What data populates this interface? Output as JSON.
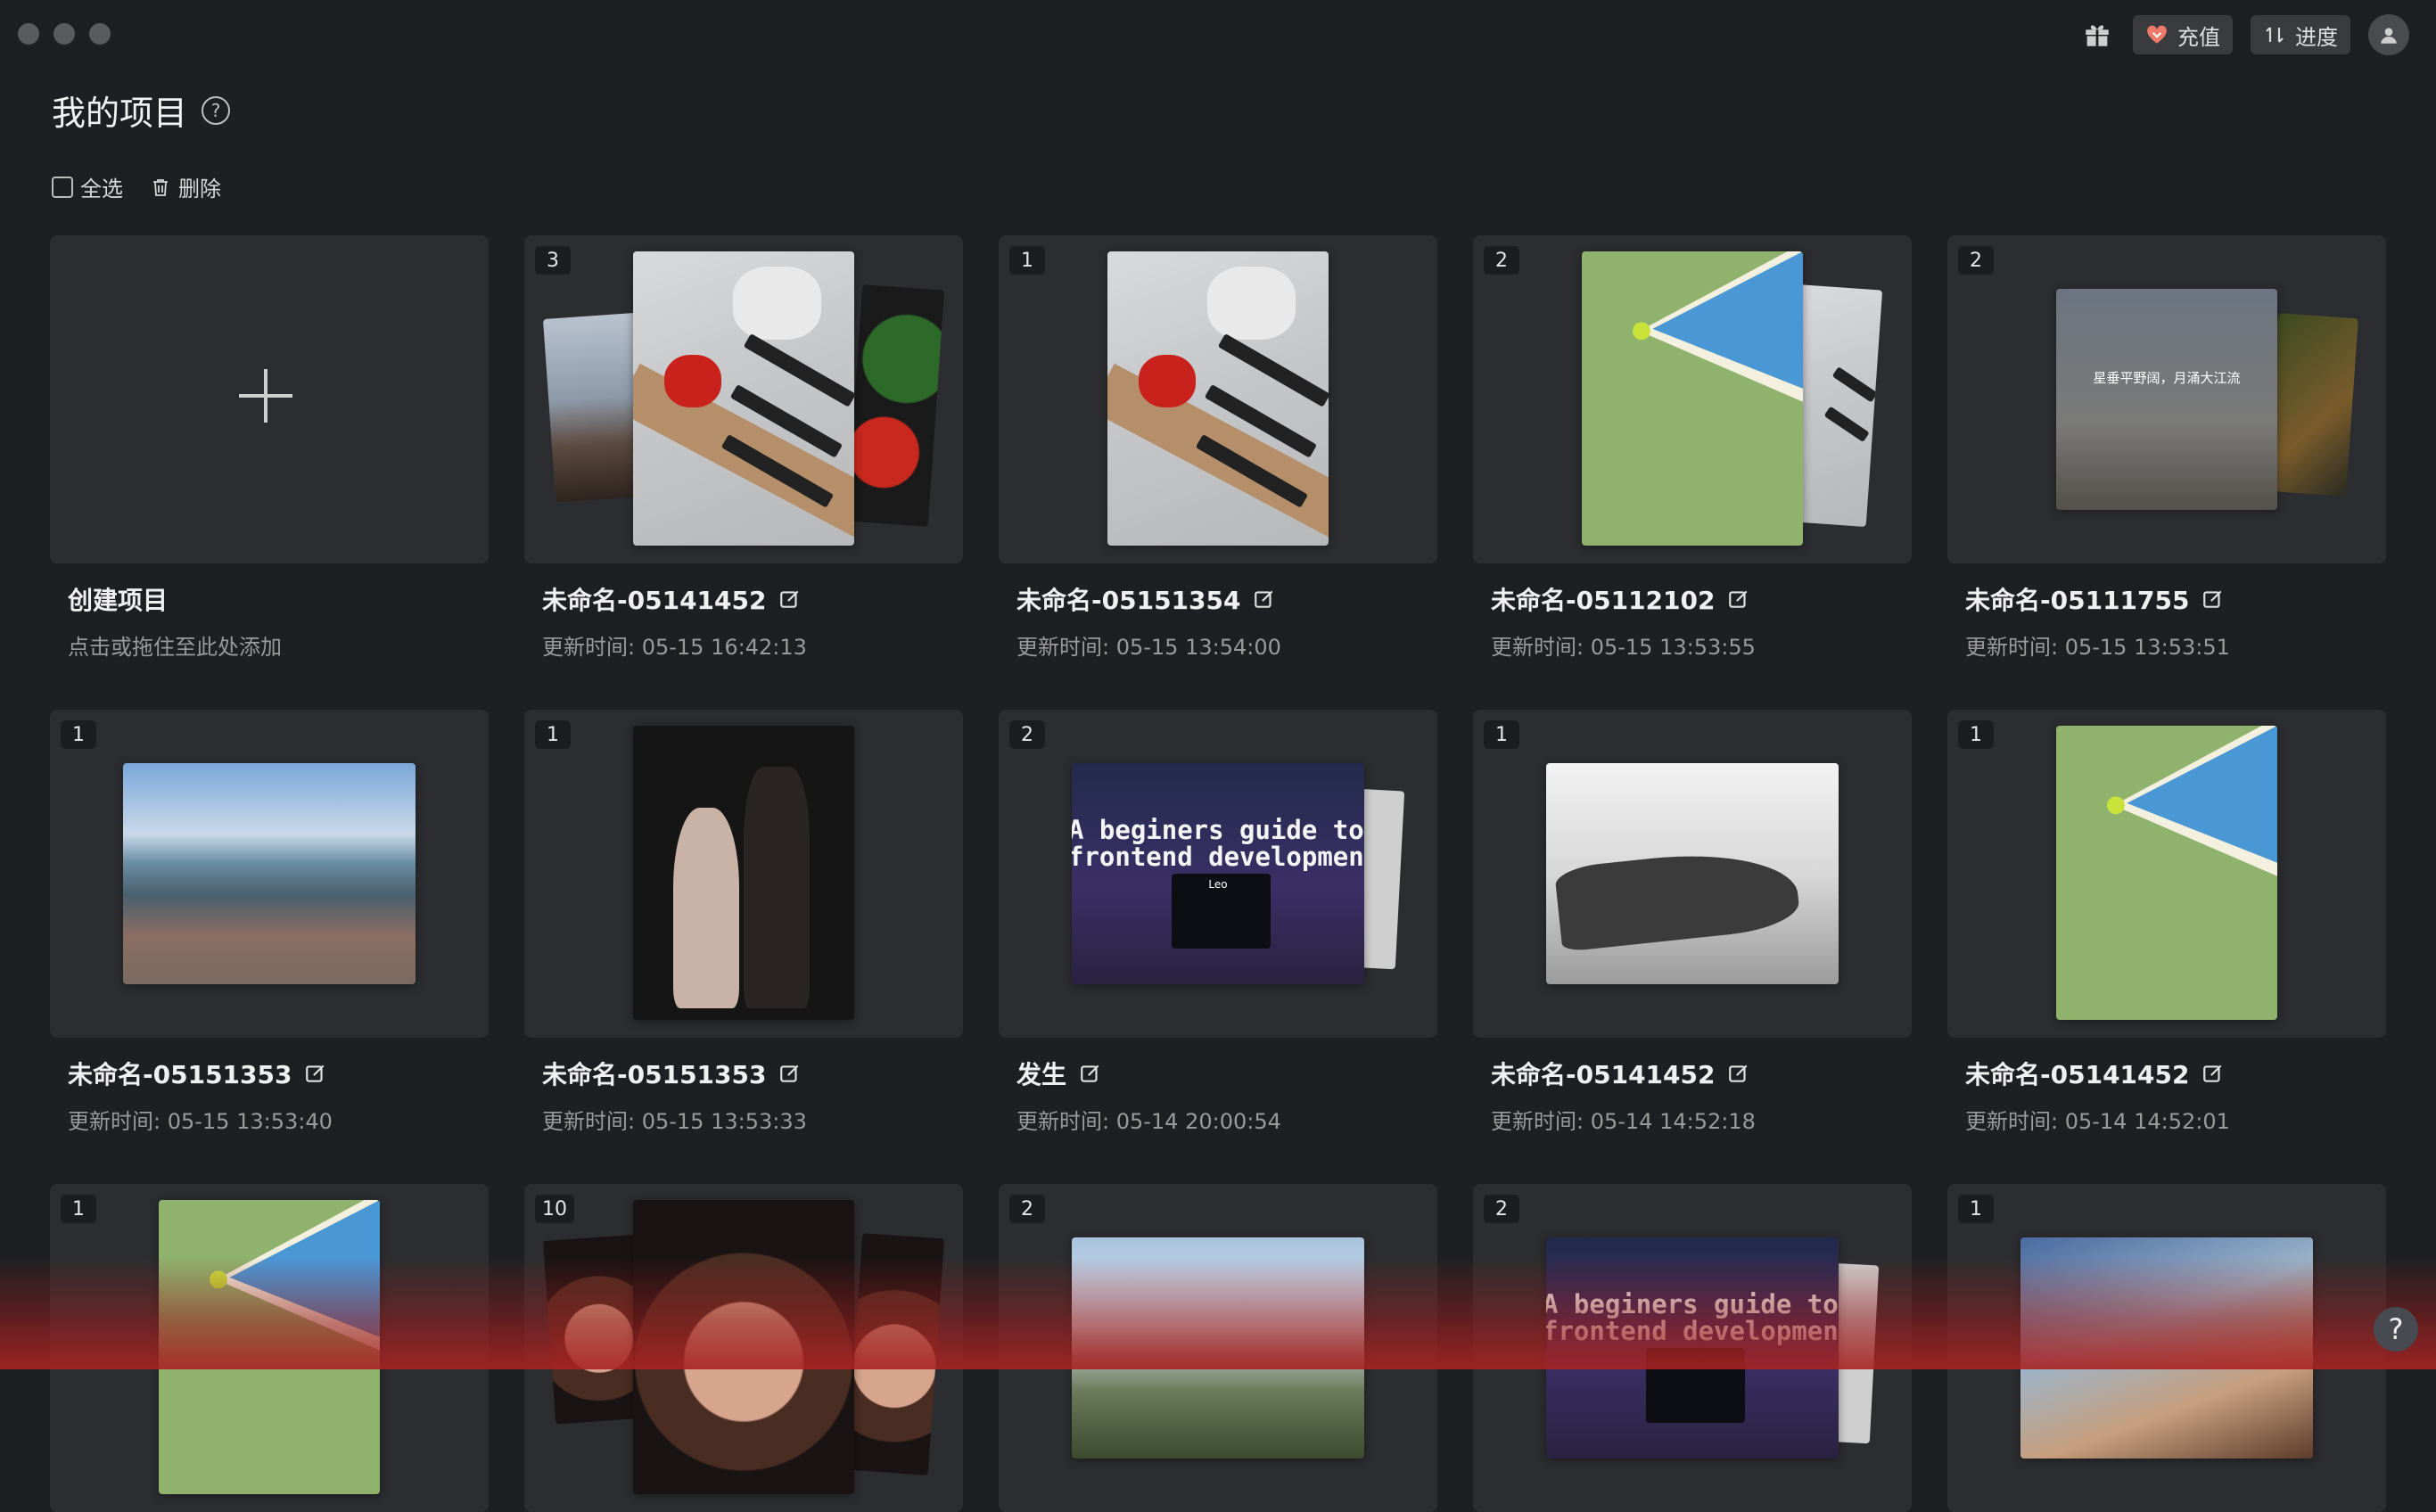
{
  "header": {
    "title": "我的项目",
    "select_all": "全选",
    "delete": "删除"
  },
  "topbar": {
    "recharge": "充值",
    "progress": "进度"
  },
  "create": {
    "title": "创建项目",
    "subtitle": "点击或拖住至此处添加"
  },
  "projects": [
    {
      "count": "3",
      "name": "未命名-05141452",
      "updated": "更新时间: 05-15 16:42:13"
    },
    {
      "count": "1",
      "name": "未命名-05151354",
      "updated": "更新时间: 05-15 13:54:00"
    },
    {
      "count": "2",
      "name": "未命名-05112102",
      "updated": "更新时间: 05-15 13:53:55"
    },
    {
      "count": "2",
      "name": "未命名-05111755",
      "updated": "更新时间: 05-15 13:53:51",
      "poster_text": "星垂平野阔，月涌大江流"
    },
    {
      "count": "1",
      "name": "未命名-05151353",
      "updated": "更新时间: 05-15 13:53:40"
    },
    {
      "count": "1",
      "name": "未命名-05151353",
      "updated": "更新时间: 05-15 13:53:33"
    },
    {
      "count": "2",
      "name": "发生",
      "updated": "更新时间: 05-14 20:00:54",
      "thumb_text": "A beginers guide to\nfrontend development",
      "thumb_sub": "Leo"
    },
    {
      "count": "1",
      "name": "未命名-05141452",
      "updated": "更新时间: 05-14 14:52:18"
    },
    {
      "count": "1",
      "name": "未命名-05141452",
      "updated": "更新时间: 05-14 14:52:01"
    },
    {
      "count": "1"
    },
    {
      "count": "10"
    },
    {
      "count": "2"
    },
    {
      "count": "2",
      "thumb_text": "A beginers guide to\nfrontend development"
    },
    {
      "count": "1"
    }
  ],
  "help_fab": "?"
}
